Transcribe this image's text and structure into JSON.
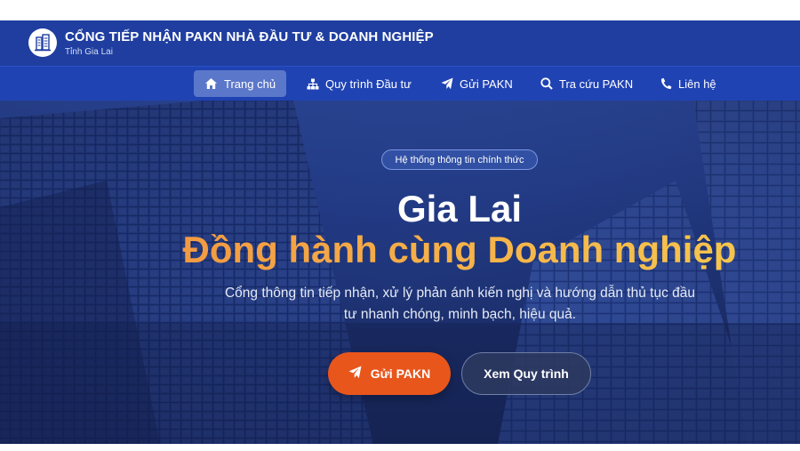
{
  "header": {
    "title": "CỔNG TIẾP NHẬN PAKN NHÀ ĐẦU TƯ & DOANH NGHIỆP",
    "subtitle": "Tỉnh Gia Lai",
    "logo_icon": "building-icon"
  },
  "nav": {
    "items": [
      {
        "label": "Trang chủ",
        "icon": "home-icon",
        "active": true
      },
      {
        "label": "Quy trình Đầu tư",
        "icon": "sitemap-icon",
        "active": false
      },
      {
        "label": "Gửi PAKN",
        "icon": "paper-plane-icon",
        "active": false
      },
      {
        "label": "Tra cứu PAKN",
        "icon": "search-icon",
        "active": false
      },
      {
        "label": "Liên hệ",
        "icon": "phone-icon",
        "active": false
      }
    ]
  },
  "hero": {
    "badge": "Hệ thống thông tin chính thức",
    "headline_line1": "Gia Lai",
    "headline_line2": "Đồng hành cùng Doanh nghiệp",
    "lead_line1": "Cổng thông tin tiếp nhận, xử lý phản ánh kiến nghị và hướng dẫn thủ tục đầu",
    "lead_line2": "tư nhanh chóng, minh bạch, hiệu quả.",
    "primary_button": "Gửi PAKN",
    "secondary_button": "Xem Quy trình"
  },
  "colors": {
    "header_bg": "#1f3ea0",
    "nav_bg": "#2043b4",
    "primary_button": "#e8561c",
    "headline_gradient_start": "#f08a3c",
    "headline_gradient_end": "#f7d24e"
  }
}
